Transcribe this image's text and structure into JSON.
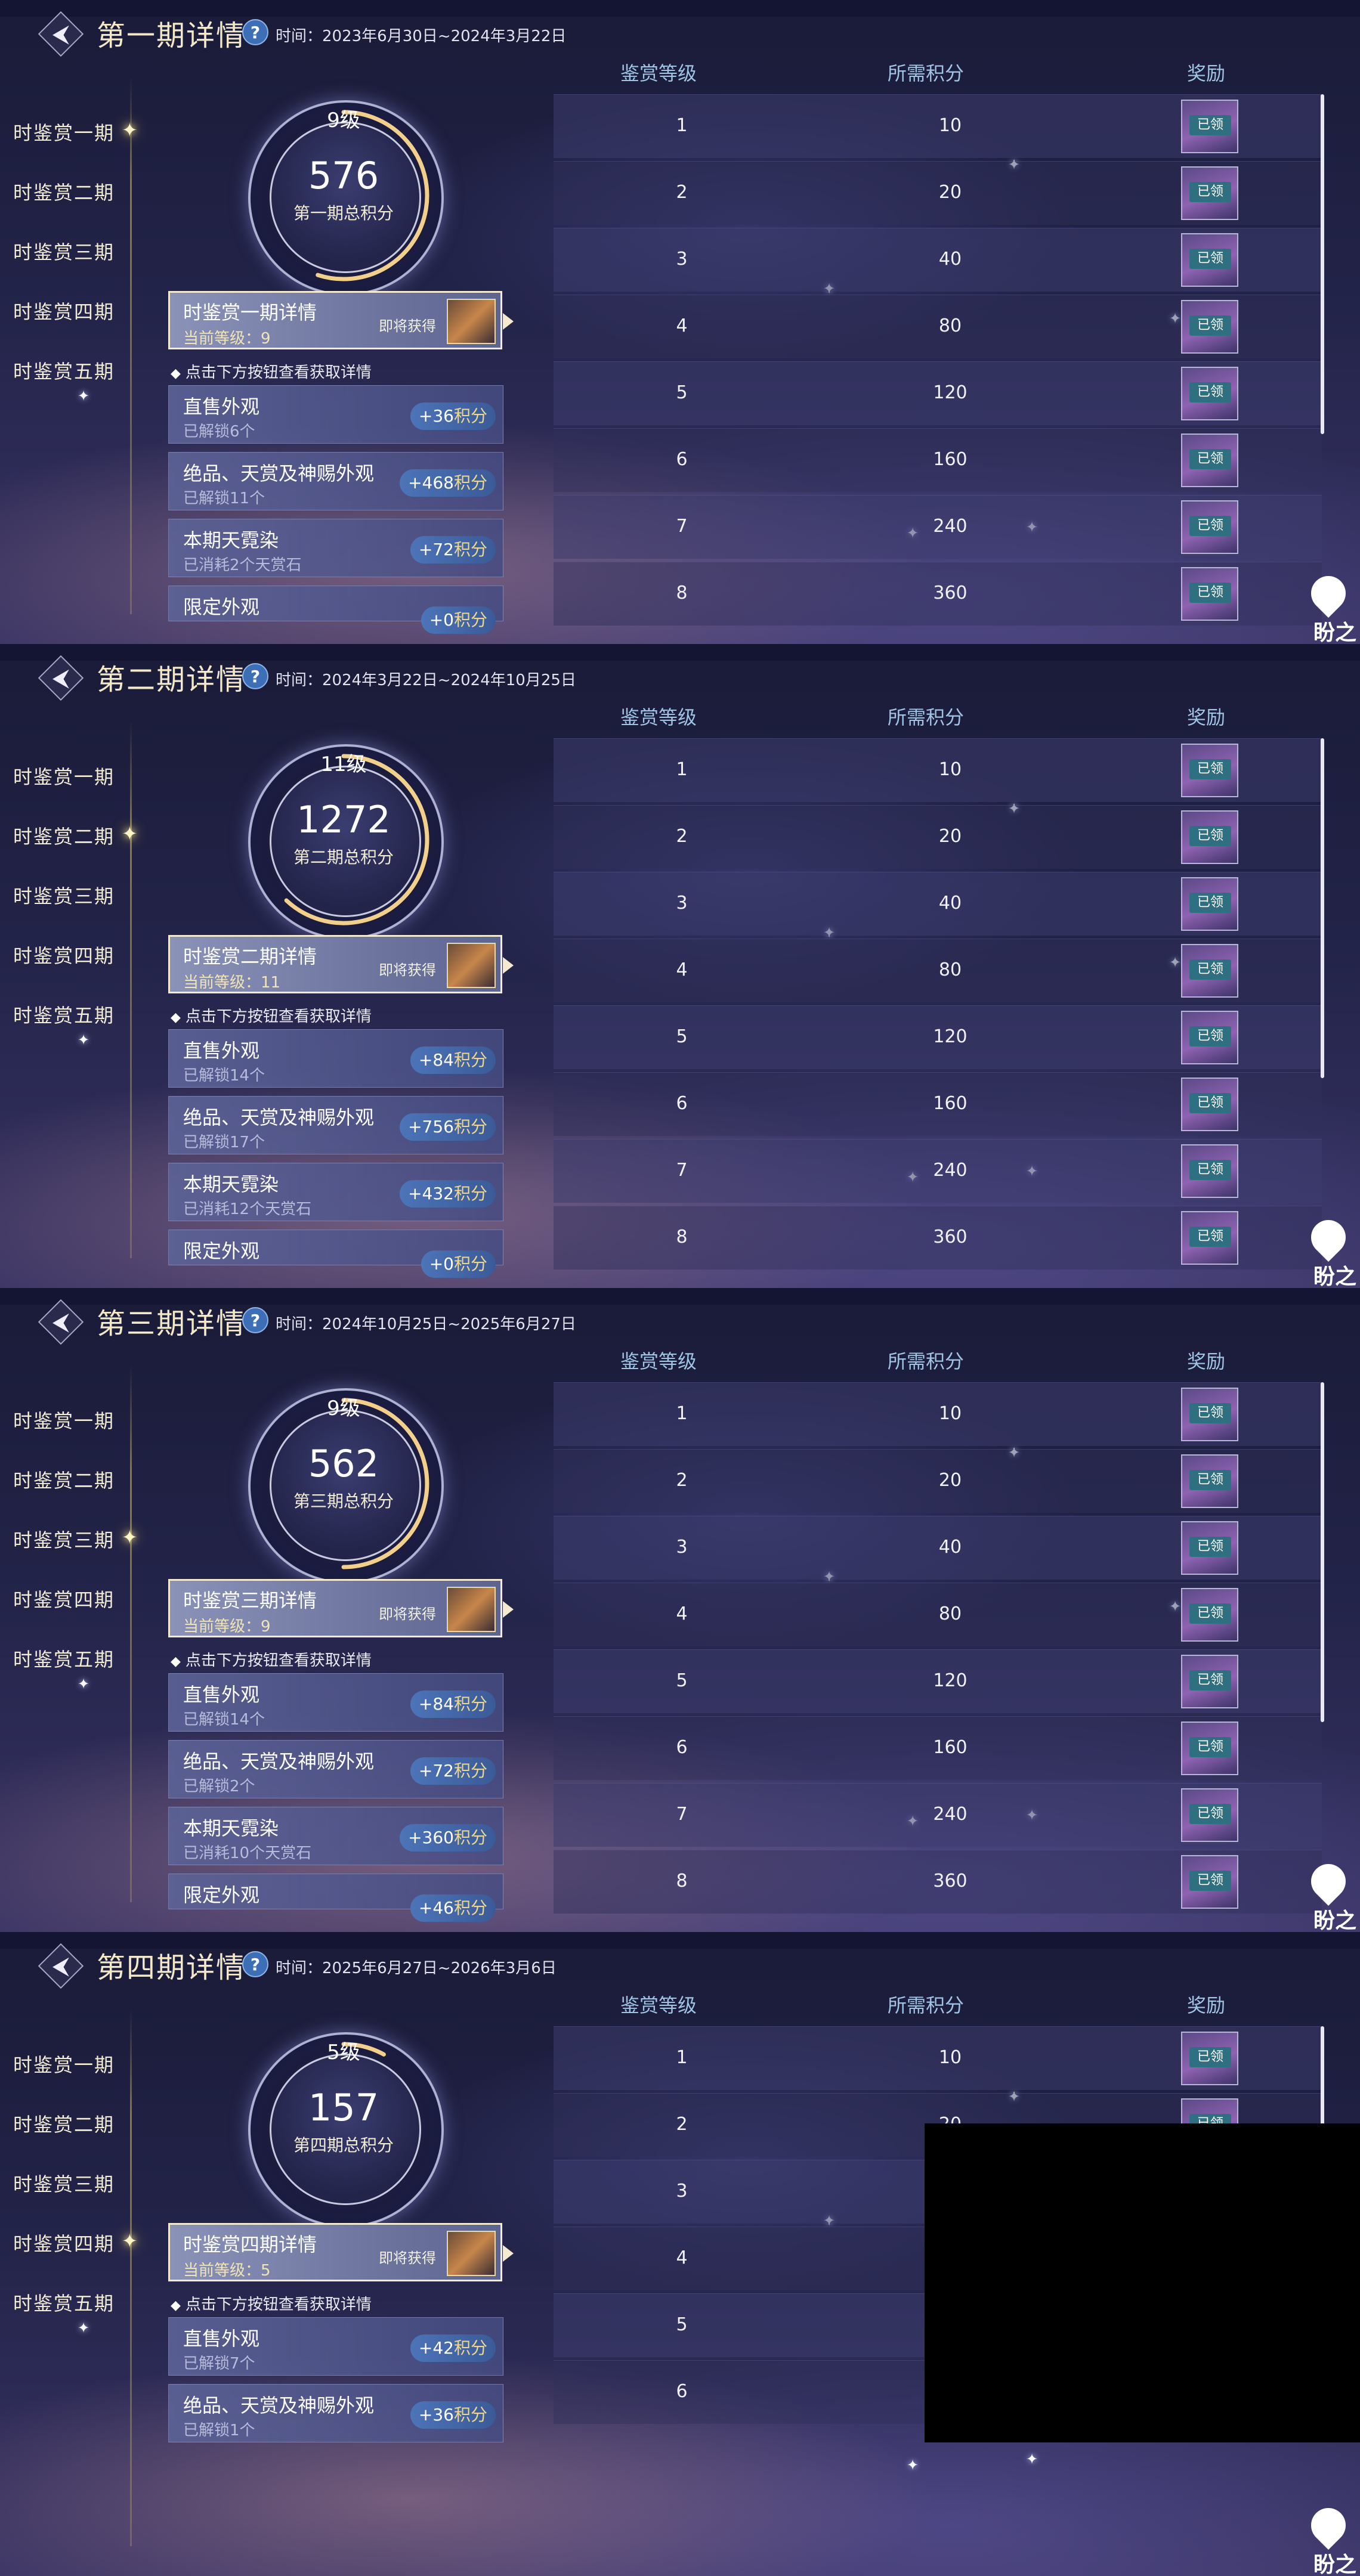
{
  "nav_items": [
    "时鉴赏一期",
    "时鉴赏二期",
    "时鉴赏三期",
    "时鉴赏四期",
    "时鉴赏五期"
  ],
  "table_headers": {
    "level": "鉴赏等级",
    "points": "所需积分",
    "reward": "奖励"
  },
  "reward_status": "已领",
  "hint": "点击下方按钮查看获取详情",
  "soon_label": "即将获得",
  "points_unit": "积分",
  "logo_text": "盼之",
  "panels": [
    {
      "title": "第一期详情",
      "time": "时间：2023年6月30日~2024年3月22日",
      "ring": {
        "level": "9级",
        "score": "576",
        "label": "第一期总积分",
        "progress": 0.55
      },
      "detail": {
        "title": "时鉴赏一期详情",
        "level": "当前等级：9"
      },
      "cards": [
        {
          "title": "直售外观",
          "sub": "已解锁6个",
          "bonus": "+36"
        },
        {
          "title": "绝品、天赏及神赐外观",
          "sub": "已解锁11个",
          "bonus": "+468"
        },
        {
          "title": "本期天霓染",
          "sub": "已消耗2个天赏石",
          "bonus": "+72"
        },
        {
          "title": "限定外观",
          "sub": "",
          "bonus": "+0"
        }
      ],
      "rows": [
        {
          "level": "1",
          "points": "10"
        },
        {
          "level": "2",
          "points": "20"
        },
        {
          "level": "3",
          "points": "40"
        },
        {
          "level": "4",
          "points": "80"
        },
        {
          "level": "5",
          "points": "120"
        },
        {
          "level": "6",
          "points": "160"
        },
        {
          "level": "7",
          "points": "240"
        },
        {
          "level": "8",
          "points": "360"
        }
      ]
    },
    {
      "title": "第二期详情",
      "time": "时间：2024年3月22日~2024年10月25日",
      "ring": {
        "level": "11级",
        "score": "1272",
        "label": "第二期总积分",
        "progress": 0.62
      },
      "detail": {
        "title": "时鉴赏二期详情",
        "level": "当前等级：11"
      },
      "cards": [
        {
          "title": "直售外观",
          "sub": "已解锁14个",
          "bonus": "+84"
        },
        {
          "title": "绝品、天赏及神赐外观",
          "sub": "已解锁17个",
          "bonus": "+756"
        },
        {
          "title": "本期天霓染",
          "sub": "已消耗12个天赏石",
          "bonus": "+432"
        },
        {
          "title": "限定外观",
          "sub": "",
          "bonus": "+0"
        }
      ],
      "rows": [
        {
          "level": "1",
          "points": "10"
        },
        {
          "level": "2",
          "points": "20"
        },
        {
          "level": "3",
          "points": "40"
        },
        {
          "level": "4",
          "points": "80"
        },
        {
          "level": "5",
          "points": "120"
        },
        {
          "level": "6",
          "points": "160"
        },
        {
          "level": "7",
          "points": "240"
        },
        {
          "level": "8",
          "points": "360"
        }
      ]
    },
    {
      "title": "第三期详情",
      "time": "时间：2024年10月25日~2025年6月27日",
      "ring": {
        "level": "9级",
        "score": "562",
        "label": "第三期总积分",
        "progress": 0.5
      },
      "detail": {
        "title": "时鉴赏三期详情",
        "level": "当前等级：9"
      },
      "cards": [
        {
          "title": "直售外观",
          "sub": "已解锁14个",
          "bonus": "+84"
        },
        {
          "title": "绝品、天赏及神赐外观",
          "sub": "已解锁2个",
          "bonus": "+72"
        },
        {
          "title": "本期天霓染",
          "sub": "已消耗10个天赏石",
          "bonus": "+360"
        },
        {
          "title": "限定外观",
          "sub": "",
          "bonus": "+46"
        }
      ],
      "rows": [
        {
          "level": "1",
          "points": "10"
        },
        {
          "level": "2",
          "points": "20"
        },
        {
          "level": "3",
          "points": "40"
        },
        {
          "level": "4",
          "points": "80"
        },
        {
          "level": "5",
          "points": "120"
        },
        {
          "level": "6",
          "points": "160"
        },
        {
          "level": "7",
          "points": "240"
        },
        {
          "level": "8",
          "points": "360"
        }
      ]
    },
    {
      "title": "第四期详情",
      "time": "时间：2025年6月27日~2026年3月6日",
      "ring": {
        "level": "5级",
        "score": "157",
        "label": "第四期总积分",
        "progress": 0.08
      },
      "detail": {
        "title": "时鉴赏四期详情",
        "level": "当前等级：5"
      },
      "cards": [
        {
          "title": "直售外观",
          "sub": "已解锁7个",
          "bonus": "+42"
        },
        {
          "title": "绝品、天赏及神赐外观",
          "sub": "已解锁1个",
          "bonus": "+36"
        }
      ],
      "rows": [
        {
          "level": "1",
          "points": "10"
        },
        {
          "level": "2",
          "points": "20"
        },
        {
          "level": "3",
          "points": ""
        },
        {
          "level": "4",
          "points": ""
        },
        {
          "level": "5",
          "points": ""
        },
        {
          "level": "6",
          "points": ""
        }
      ]
    }
  ],
  "colors": {
    "title_gold": "#f3e8c8",
    "table_header": "#9fc4e4",
    "badge": "#4c74b8",
    "background": "#1a1b38"
  }
}
